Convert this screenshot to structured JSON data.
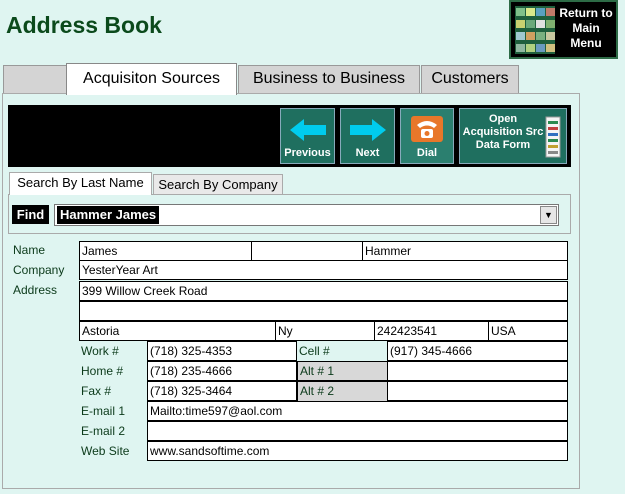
{
  "app": {
    "title": "Address Book"
  },
  "return_button": {
    "label_lines": [
      "Return to",
      "Main",
      "Menu"
    ]
  },
  "tabs": [
    {
      "label": "",
      "active": false
    },
    {
      "label": "Acquisiton Sources",
      "active": true
    },
    {
      "label": "Business to Business",
      "active": false
    },
    {
      "label": "Customers",
      "active": false
    }
  ],
  "toolbar": {
    "previous": "Previous",
    "next": "Next",
    "dial": "Dial",
    "open_lines": [
      "Open",
      "Acquisition Src",
      "Data  Form"
    ]
  },
  "search_tabs": [
    {
      "label": "Search By Last Name",
      "active": true
    },
    {
      "label": "Search By Company",
      "active": false
    }
  ],
  "find": {
    "label": "Find",
    "value": "Hammer James"
  },
  "form": {
    "labels": {
      "name": "Name",
      "company": "Company",
      "address": "Address",
      "work": "Work #",
      "home": "Home #",
      "fax": "Fax #",
      "email1": "E-mail 1",
      "email2": "E-mail  2",
      "web": "Web Site",
      "cell": "Cell #",
      "alt1": "Alt # 1",
      "alt2": "Alt # 2"
    },
    "first_name": "James",
    "middle_name": "",
    "last_name": "Hammer",
    "company": "YesterYear Art",
    "address1": "399 Willow Creek Road",
    "address2": "",
    "city": "Astoria",
    "state": "Ny",
    "zip": "242423541",
    "country": "USA",
    "work": "(718) 325-4353",
    "home": "(718) 235-4666",
    "fax": "(718) 325-3464",
    "cell": "(917) 345-4666",
    "alt1": "",
    "alt2": "",
    "email1": "Mailto:time597@aol.com",
    "email2": "",
    "web": "www.sandsoftime.com"
  },
  "colors": {
    "title": "#0b4a1c",
    "background": "#dff5f1",
    "toolbar_button": "#1f6f5f",
    "arrow": "#00ccee",
    "dial_icon": "#e8772a"
  },
  "icons": {
    "previous": "left-arrow-icon",
    "next": "right-arrow-icon",
    "dial": "telephone-icon",
    "open": "document-icon",
    "return": "thumbnail-grid-icon",
    "dropdown": "chevron-down-icon"
  }
}
